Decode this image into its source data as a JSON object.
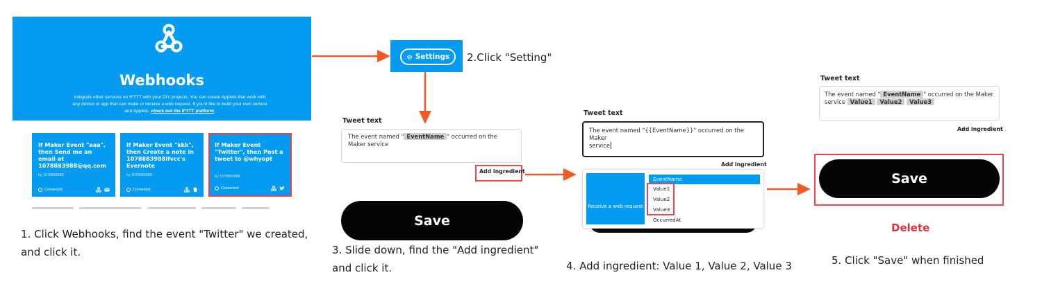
{
  "colors": {
    "ifttt_blue": "#049bf0",
    "highlight_red": "#e5484b",
    "arrow_orange": "#f15a24",
    "delete_red": "#d8323a",
    "black": "#050505"
  },
  "step1": {
    "service_title": "Webhooks",
    "description": "Integrate other services on IFTTT with your DIY projects. You can create Applets that work with any device or app that can make or receive a web request. If you'd like to build your own service and Applets,",
    "platform_link": "check out the IFTTT platform",
    "applets": [
      {
        "title": "If Maker Event \"aaa\", then Send me an email at 1078883988@qq.com",
        "by": "by 1078883988",
        "status": "Connected",
        "icons": [
          "webhooks-icon",
          "email-icon"
        ]
      },
      {
        "title": "If Maker Event \"kkk\", then Create a note in 1078883988ifvcc's Evernote",
        "by": "by 1078883988",
        "status": "Connected",
        "icons": [
          "webhooks-icon",
          "evernote-icon"
        ]
      },
      {
        "title": "If Maker Event \"Twitter\", then Post a tweet to @whyopt",
        "by": "by 1078883988",
        "status": "Connected",
        "icons": [
          "webhooks-icon",
          "twitter-icon"
        ]
      }
    ],
    "caption_line1": "1. Click Webhooks, find the event \"Twitter\" we created,",
    "caption_line2": "and click it."
  },
  "step2": {
    "settings_label": "Settings",
    "settings_icon": "gear-icon",
    "caption": "2.Click \"Setting\""
  },
  "step3": {
    "label": "Tweet text",
    "text_before": "The event named \"",
    "ingredient": "EventName",
    "text_after": "\" occurred on the Maker service",
    "add_ingredient": "Add ingredient",
    "save_label": "Save",
    "caption_line1": "3. Slide down, find the \"Add ingredient\"",
    "caption_line2": "and click it."
  },
  "step4": {
    "label": "Tweet text",
    "text_line1": "The event named \"{{EventName}}\" occurred on the Maker",
    "text_line2": "service",
    "add_ingredient": "Add ingredient",
    "trigger_label": "Receive a web request",
    "ingredients": [
      "EventName",
      "Value1",
      "Value2",
      "Value3",
      "OccurredAt"
    ],
    "selected_ingredient": "EventName",
    "caption": "4. Add ingredient: Value 1, Value 2, Value 3"
  },
  "step5": {
    "label": "Tweet text",
    "text_before": "The event named \"",
    "ingredient": "EventName",
    "text_after": "\" occurred on the Maker",
    "text_line2": "service",
    "values": [
      "Value1",
      "Value2",
      "Value3"
    ],
    "add_ingredient": "Add ingredient",
    "save_label": "Save",
    "delete_label": "Delete",
    "caption": "5. Click \"Save\" when finished"
  }
}
